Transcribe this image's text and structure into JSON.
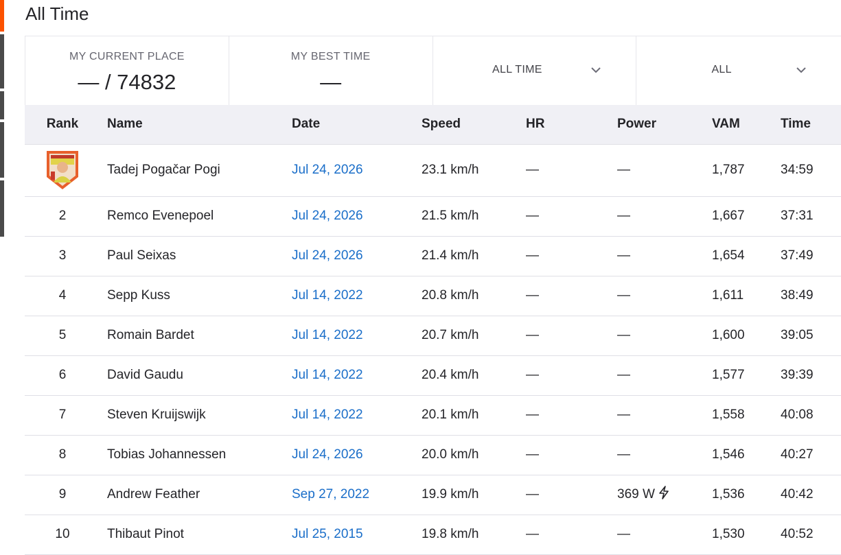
{
  "page": {
    "title": "All Time"
  },
  "stats": {
    "current_place_label": "MY CURRENT PLACE",
    "current_place_value": "— / 74832",
    "best_time_label": "MY BEST TIME",
    "best_time_value": "—"
  },
  "filters": {
    "period_selected": "ALL TIME",
    "group_selected": "ALL"
  },
  "table": {
    "headers": {
      "rank": "Rank",
      "name": "Name",
      "date": "Date",
      "speed": "Speed",
      "hr": "HR",
      "power": "Power",
      "vam": "VAM",
      "time": "Time"
    },
    "rows": [
      {
        "rank": "",
        "crown": true,
        "name": "Tadej Pogačar Pogi",
        "date": "Jul 24, 2026",
        "speed": "23.1 km/h",
        "hr": "—",
        "power": "—",
        "power_icon": "",
        "vam": "1,787",
        "time": "34:59"
      },
      {
        "rank": "2",
        "name": "Remco Evenepoel",
        "date": "Jul 24, 2026",
        "speed": "21.5 km/h",
        "hr": "—",
        "power": "—",
        "power_icon": "",
        "vam": "1,667",
        "time": "37:31"
      },
      {
        "rank": "3",
        "name": "Paul Seixas",
        "date": "Jul 24, 2026",
        "speed": "21.4 km/h",
        "hr": "—",
        "power": "—",
        "power_icon": "",
        "vam": "1,654",
        "time": "37:49"
      },
      {
        "rank": "4",
        "name": "Sepp Kuss",
        "date": "Jul 14, 2022",
        "speed": "20.8 km/h",
        "hr": "—",
        "power": "—",
        "power_icon": "",
        "vam": "1,611",
        "time": "38:49"
      },
      {
        "rank": "5",
        "name": "Romain Bardet",
        "date": "Jul 14, 2022",
        "speed": "20.7 km/h",
        "hr": "—",
        "power": "—",
        "power_icon": "",
        "vam": "1,600",
        "time": "39:05"
      },
      {
        "rank": "6",
        "name": "David Gaudu",
        "date": "Jul 14, 2022",
        "speed": "20.4 km/h",
        "hr": "—",
        "power": "—",
        "power_icon": "",
        "vam": "1,577",
        "time": "39:39"
      },
      {
        "rank": "7",
        "name": "Steven Kruijswijk",
        "date": "Jul 14, 2022",
        "speed": "20.1 km/h",
        "hr": "—",
        "power": "—",
        "power_icon": "",
        "vam": "1,558",
        "time": "40:08"
      },
      {
        "rank": "8",
        "name": "Tobias Johannessen",
        "date": "Jul 24, 2026",
        "speed": "20.0 km/h",
        "hr": "—",
        "power": "—",
        "power_icon": "",
        "vam": "1,546",
        "time": "40:27"
      },
      {
        "rank": "9",
        "name": "Andrew Feather",
        "date": "Sep 27, 2022",
        "speed": "19.9 km/h",
        "hr": "—",
        "power": "369 W",
        "power_icon": "lightning-bolt-icon",
        "vam": "1,536",
        "time": "40:42"
      },
      {
        "rank": "10",
        "name": "Thibaut Pinot",
        "date": "Jul 25, 2015",
        "speed": "19.8 km/h",
        "hr": "—",
        "power": "—",
        "power_icon": "",
        "vam": "1,530",
        "time": "40:52"
      }
    ]
  },
  "colors": {
    "accent": "#fc5200",
    "link": "#1a6ec9",
    "header_bg": "#f0f0f5",
    "crown_badge": "#e8602c"
  }
}
